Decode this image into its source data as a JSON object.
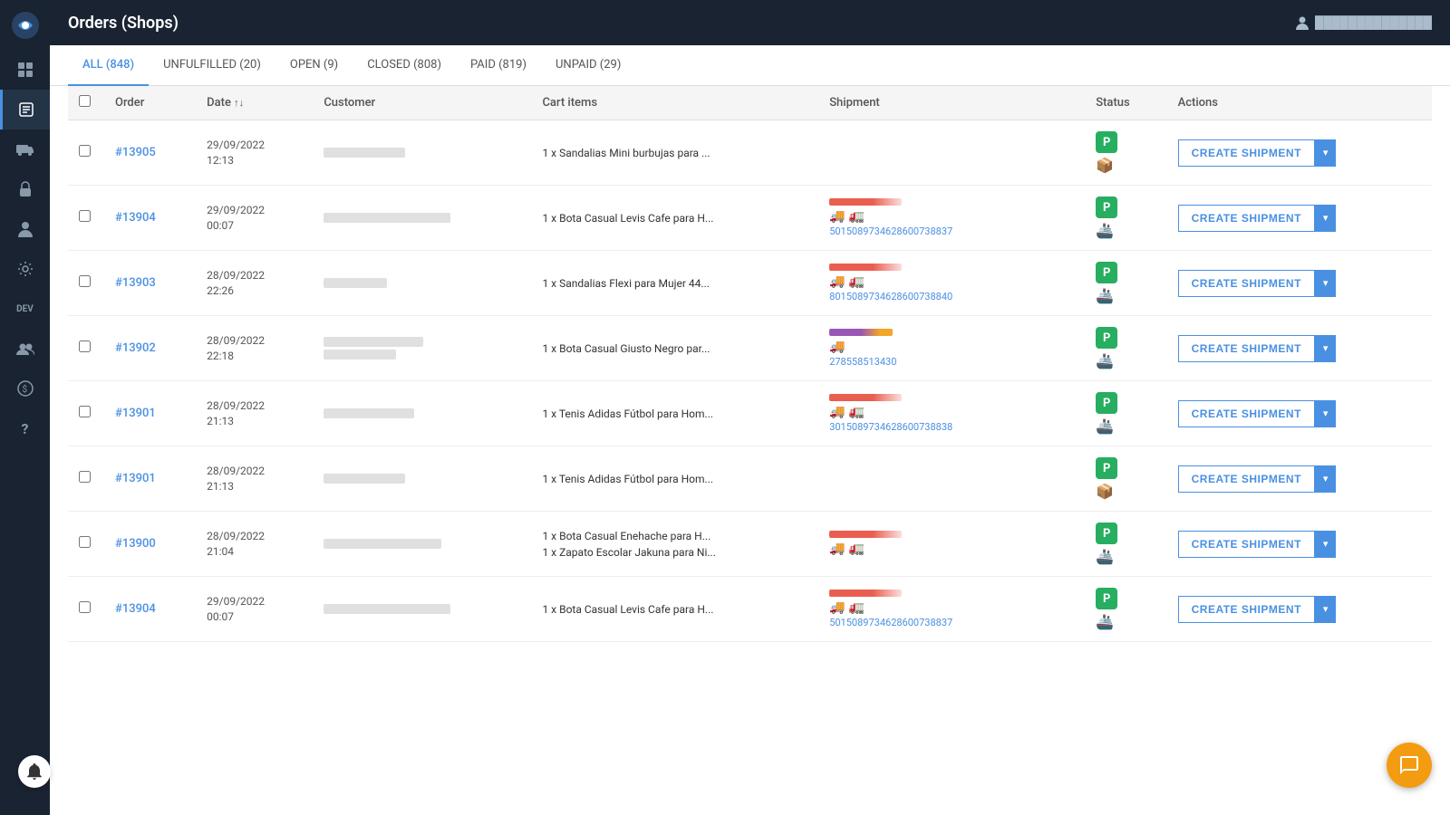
{
  "topbar": {
    "title": "Orders (Shops)",
    "user_label": "User Account"
  },
  "tabs": [
    {
      "label": "ALL (848)",
      "id": "all",
      "active": true
    },
    {
      "label": "UNFULFILLED (20)",
      "id": "unfulfilled",
      "active": false
    },
    {
      "label": "OPEN (9)",
      "id": "open",
      "active": false
    },
    {
      "label": "CLOSED (808)",
      "id": "closed",
      "active": false
    },
    {
      "label": "PAID (819)",
      "id": "paid",
      "active": false
    },
    {
      "label": "UNPAID (29)",
      "id": "unpaid",
      "active": false
    }
  ],
  "table": {
    "columns": [
      "Order",
      "Date",
      "Customer",
      "Cart items",
      "Shipment",
      "Status",
      "Actions"
    ],
    "create_shipment_label": "CREATE SHIPMENT",
    "rows": [
      {
        "id": "row-13905",
        "order": "#13905",
        "date_line1": "29/09/2022",
        "date_line2": "12:13",
        "cart_items": "1 x Sandalias Mini burbujas para ...",
        "tracking": "",
        "has_shipment_bar": false,
        "bar_type": "none"
      },
      {
        "id": "row-13904a",
        "order": "#13904",
        "date_line1": "29/09/2022",
        "date_line2": "00:07",
        "cart_items": "1 x Bota Casual Levis Cafe para H...",
        "tracking": "501508973462860073883​7",
        "has_shipment_bar": true,
        "bar_type": "red"
      },
      {
        "id": "row-13903",
        "order": "#13903",
        "date_line1": "28/09/2022",
        "date_line2": "22:26",
        "cart_items": "1 x Sandalias Flexi para Mujer 44...",
        "tracking": "801508973462860073884​0",
        "has_shipment_bar": true,
        "bar_type": "red"
      },
      {
        "id": "row-13902",
        "order": "#13902",
        "date_line1": "28/09/2022",
        "date_line2": "22:18",
        "cart_items": "1 x Bota Casual Giusto Negro par...",
        "tracking": "278558513430",
        "has_shipment_bar": true,
        "bar_type": "purple"
      },
      {
        "id": "row-13901a",
        "order": "#13901",
        "date_line1": "28/09/2022",
        "date_line2": "21:13",
        "cart_items": "1 x Tenis Adidas Fútbol para Hom...",
        "tracking": "301508973462860073883​8",
        "has_shipment_bar": true,
        "bar_type": "red"
      },
      {
        "id": "row-13901b",
        "order": "#13901",
        "date_line1": "28/09/2022",
        "date_line2": "21:13",
        "cart_items": "1 x Tenis Adidas Fútbol para Hom...",
        "tracking": "",
        "has_shipment_bar": false,
        "bar_type": "none"
      },
      {
        "id": "row-13900",
        "order": "#13900",
        "date_line1": "28/09/2022",
        "date_line2": "21:04",
        "cart_items": "1 x Bota Casual Enehache para H...\n1 x Zapato Escolar Jakuna para Ni...",
        "tracking": "",
        "has_shipment_bar": true,
        "bar_type": "red"
      },
      {
        "id": "row-13904b",
        "order": "#13904",
        "date_line1": "29/09/2022",
        "date_line2": "00:07",
        "cart_items": "1 x Bota Casual Levis Cafe para H...",
        "tracking": "501508973462860073883​7",
        "has_shipment_bar": true,
        "bar_type": "red"
      }
    ]
  },
  "sidebar": {
    "icons": [
      {
        "name": "grid-icon",
        "symbol": "⊞",
        "active": false
      },
      {
        "name": "orders-icon",
        "symbol": "📋",
        "active": true
      },
      {
        "name": "truck-icon",
        "symbol": "🚚",
        "active": false
      },
      {
        "name": "lock-icon",
        "symbol": "🔒",
        "active": false
      },
      {
        "name": "person-icon",
        "symbol": "👤",
        "active": false
      },
      {
        "name": "settings-icon",
        "symbol": "⚙",
        "active": false
      },
      {
        "name": "dev-icon",
        "symbol": "DEV",
        "active": false
      },
      {
        "name": "team-icon",
        "symbol": "👥",
        "active": false
      },
      {
        "name": "billing-icon",
        "symbol": "💰",
        "active": false
      },
      {
        "name": "help-icon",
        "symbol": "?",
        "active": false
      }
    ]
  },
  "chat": {
    "icon": "💬"
  },
  "notification": {
    "icon": "🔔"
  }
}
